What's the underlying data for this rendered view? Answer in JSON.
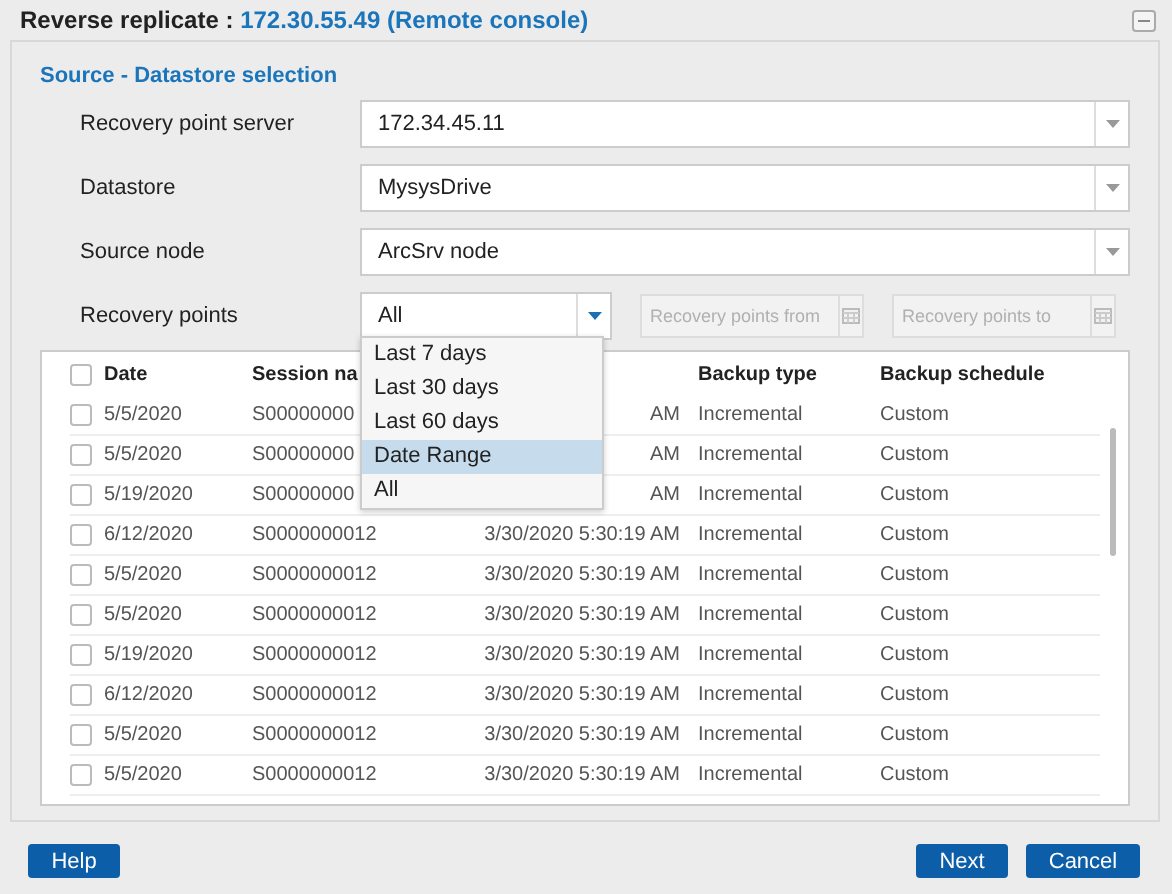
{
  "window": {
    "title": "Reverse replicate : ",
    "title_host": "172.30.55.49 (Remote console)"
  },
  "section": {
    "title": "Source - Datastore selection"
  },
  "fields": [
    {
      "label": "Recovery point server",
      "value": "172.34.45.11"
    },
    {
      "label": "Datastore",
      "value": "MysysDrive"
    },
    {
      "label": "Source node",
      "value": "ArcSrv node"
    }
  ],
  "recovery_points": {
    "label": "Recovery points",
    "value": "All",
    "expanded": true,
    "from_placeholder": "Recovery points from",
    "to_placeholder": "Recovery points to",
    "options": [
      {
        "label": "Last 7 days",
        "highlighted": false
      },
      {
        "label": "Last 30 days",
        "highlighted": false
      },
      {
        "label": "Last 60 days",
        "highlighted": false
      },
      {
        "label": "Date Range",
        "highlighted": true
      },
      {
        "label": "All",
        "highlighted": false
      }
    ]
  },
  "table": {
    "header_checked": false,
    "columns": [
      "Date",
      "Session na",
      "",
      "Backup type",
      "Backup schedule"
    ],
    "rows": [
      {
        "checked": false,
        "date": "5/5/2020",
        "session": "S00000000",
        "time": "AM",
        "type": "Incremental",
        "schedule": "Custom"
      },
      {
        "checked": false,
        "date": "5/5/2020",
        "session": "S00000000",
        "time": "AM",
        "type": "Incremental",
        "schedule": "Custom"
      },
      {
        "checked": false,
        "date": "5/19/2020",
        "session": "S00000000",
        "time": "AM",
        "type": "Incremental",
        "schedule": "Custom"
      },
      {
        "checked": false,
        "date": "6/12/2020",
        "session": "S0000000012",
        "time": "3/30/2020 5:30:19 AM",
        "type": "Incremental",
        "schedule": "Custom"
      },
      {
        "checked": false,
        "date": "5/5/2020",
        "session": "S0000000012",
        "time": "3/30/2020 5:30:19 AM",
        "type": "Incremental",
        "schedule": "Custom"
      },
      {
        "checked": false,
        "date": "5/5/2020",
        "session": "S0000000012",
        "time": "3/30/2020 5:30:19 AM",
        "type": "Incremental",
        "schedule": "Custom"
      },
      {
        "checked": false,
        "date": "5/19/2020",
        "session": "S0000000012",
        "time": "3/30/2020 5:30:19 AM",
        "type": "Incremental",
        "schedule": "Custom"
      },
      {
        "checked": false,
        "date": "6/12/2020",
        "session": "S0000000012",
        "time": "3/30/2020 5:30:19 AM",
        "type": "Incremental",
        "schedule": "Custom"
      },
      {
        "checked": false,
        "date": "5/5/2020",
        "session": "S0000000012",
        "time": "3/30/2020 5:30:19 AM",
        "type": "Incremental",
        "schedule": "Custom"
      },
      {
        "checked": false,
        "date": "5/5/2020",
        "session": "S0000000012",
        "time": "3/30/2020 5:30:19 AM",
        "type": "Incremental",
        "schedule": "Custom"
      }
    ]
  },
  "buttons": {
    "help": "Help",
    "next": "Next",
    "cancel": "Cancel"
  }
}
